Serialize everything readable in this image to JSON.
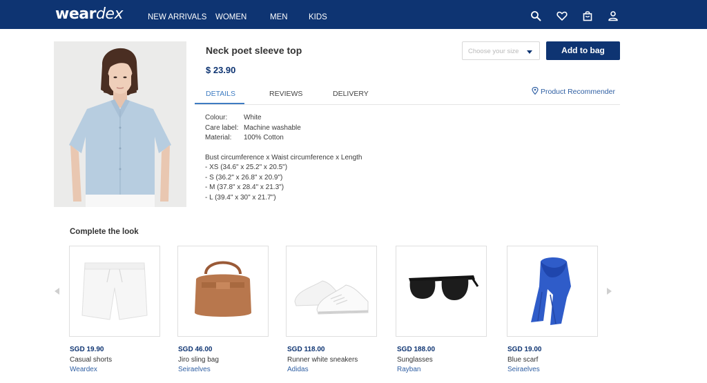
{
  "header": {
    "logo_part1": "wear",
    "logo_part2": "dex",
    "nav": [
      "NEW ARRIVALS",
      "WOMEN",
      "MEN",
      "KIDS"
    ],
    "icons": [
      "search-icon",
      "heart-icon",
      "bag-icon",
      "user-icon"
    ],
    "bg_color": "#0e3472"
  },
  "product": {
    "title": "Neck poet sleeve top",
    "price": "$ 23.90",
    "size_placeholder": "Choose your size",
    "add_button": "Add to bag",
    "tabs": [
      "DETAILS",
      "REVIEWS",
      "DELIVERY"
    ],
    "active_tab": "DETAILS",
    "recommender": "Product Recommender",
    "details": [
      {
        "label": "Colour:",
        "value": "White"
      },
      {
        "label": "Care label:",
        "value": "Machine washable"
      },
      {
        "label": "Material:",
        "value": "100% Cotton"
      }
    ],
    "size_heading": "Bust circumference x Waist circumference x Length",
    "sizes": [
      "- XS (34.6\" x 25.2\" x 20.5\")",
      "- S (36.2\" x 26.8\" x 20.9\")",
      "- M (37.8\" x 28.4\" x 21.3\")",
      "- L (39.4\" x 30\" x 21.7\")"
    ]
  },
  "complete_the_look": {
    "title": "Complete the look",
    "items": [
      {
        "price": "SGD 19.90",
        "name": "Casual shorts",
        "brand": "Weardex"
      },
      {
        "price": "SGD 46.00",
        "name": "Jiro sling bag",
        "brand": "Seiraelves"
      },
      {
        "price": "SGD 118.00",
        "name": "Runner white sneakers",
        "brand": "Adidas"
      },
      {
        "price": "SGD 188.00",
        "name": "Sunglasses",
        "brand": "Rayban"
      },
      {
        "price": "SGD 19.00",
        "name": "Blue scarf",
        "brand": "Seiraelves"
      }
    ]
  }
}
